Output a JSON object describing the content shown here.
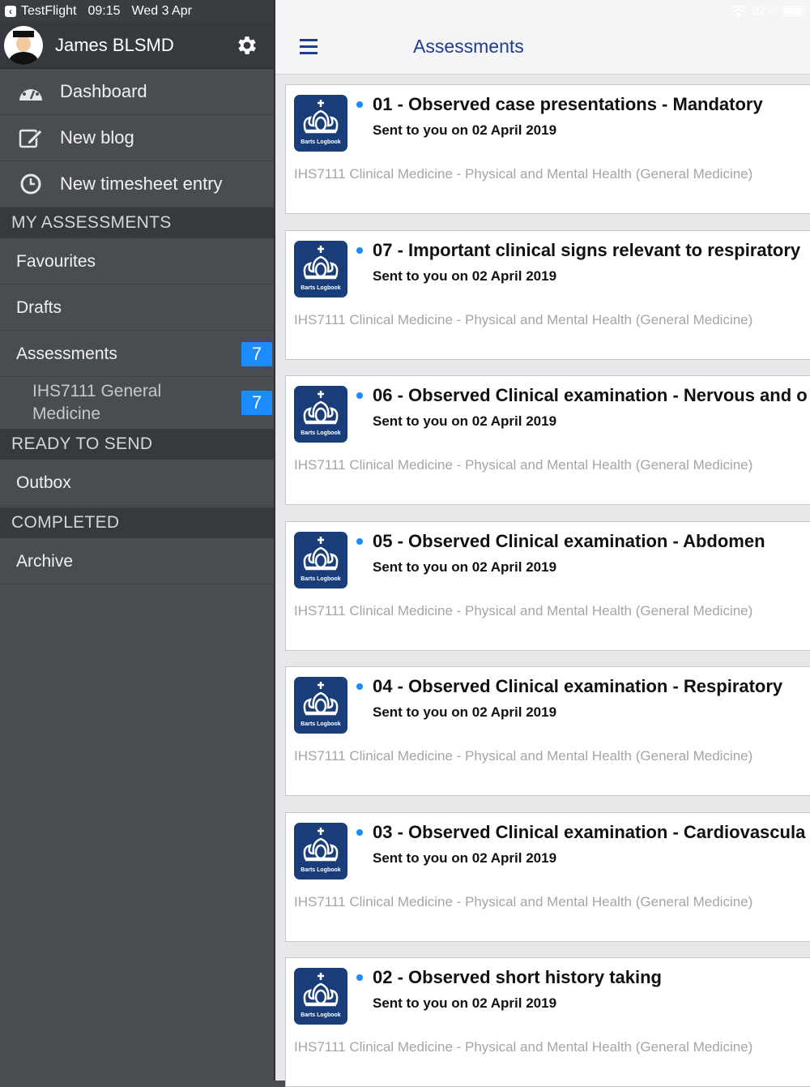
{
  "status": {
    "app": "TestFlight",
    "time": "09:15",
    "date": "Wed 3 Apr",
    "battery": "92%"
  },
  "profile": {
    "name": "James BLSMD"
  },
  "nav": {
    "dashboard": "Dashboard",
    "new_blog": "New blog",
    "new_timesheet": "New timesheet entry"
  },
  "sections": {
    "my_assessments": "MY ASSESSMENTS",
    "ready_to_send": "READY TO SEND",
    "completed": "COMPLETED"
  },
  "items": {
    "favourites": "Favourites",
    "drafts": "Drafts",
    "assessments": "Assessments",
    "assessments_count": "7",
    "module": "IHS7111 General Medicine",
    "module_count": "7",
    "outbox": "Outbox",
    "archive": "Archive"
  },
  "header": {
    "title": "Assessments"
  },
  "logo_text": "Barts Logbook",
  "cards": [
    {
      "title": "01 - Observed case presentations - Mandatory",
      "sent": "Sent to you on 02 April 2019",
      "module": "IHS7111 Clinical Medicine - Physical and Mental Health (General Medicine)"
    },
    {
      "title": "07 - Important clinical signs relevant to respiratory",
      "sent": "Sent to you on 02 April 2019",
      "module": "IHS7111 Clinical Medicine - Physical and Mental Health (General Medicine)"
    },
    {
      "title": "06 - Observed Clinical examination - Nervous and o",
      "sent": "Sent to you on 02 April 2019",
      "module": "IHS7111 Clinical Medicine - Physical and Mental Health (General Medicine)"
    },
    {
      "title": "05 - Observed Clinical examination - Abdomen",
      "sent": "Sent to you on 02 April 2019",
      "module": "IHS7111 Clinical Medicine - Physical and Mental Health (General Medicine)"
    },
    {
      "title": "04 - Observed Clinical examination - Respiratory",
      "sent": "Sent to you on 02 April 2019",
      "module": "IHS7111 Clinical Medicine - Physical and Mental Health (General Medicine)"
    },
    {
      "title": "03 - Observed Clinical examination - Cardiovascula",
      "sent": "Sent to you on 02 April 2019",
      "module": "IHS7111 Clinical Medicine - Physical and Mental Health (General Medicine)"
    },
    {
      "title": "02 - Observed short history taking",
      "sent": "Sent to you on 02 April 2019",
      "module": "IHS7111 Clinical Medicine - Physical and Mental Health (General Medicine)"
    }
  ]
}
